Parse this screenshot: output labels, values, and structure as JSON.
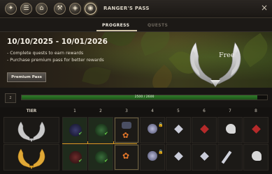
{
  "topbar": {
    "title": "RANGER'S PASS",
    "icons": [
      "quest-icon",
      "tasks-icon",
      "map-icon",
      "pickaxe-icon",
      "bag-icon",
      "pass-icon",
      "camp-icon"
    ],
    "close": "×"
  },
  "tabs": [
    {
      "label": "PROGRESS",
      "active": true
    },
    {
      "label": "QUESTS",
      "active": false
    }
  ],
  "banner": {
    "date_range": "10/10/2025 - 10/01/2026",
    "lines": [
      "- Complete quests to earn rewards",
      "- Purchase premium pass for better rewards"
    ],
    "premium_button": "Premium Pass",
    "free_label": "Free"
  },
  "progress": {
    "level": "2",
    "text": "2500 / 2600",
    "fraction": 0.96,
    "fill_color": "#2f7a2a"
  },
  "table": {
    "tier_header": "TIER",
    "columns": [
      "1",
      "2",
      "3",
      "4",
      "5",
      "6",
      "7",
      "8"
    ],
    "tiers": [
      {
        "name": "free",
        "emblem": "silver-wings-icon"
      },
      {
        "name": "premium",
        "emblem": "gold-wings-icon"
      }
    ],
    "premium_accent": "#d49a1f"
  }
}
